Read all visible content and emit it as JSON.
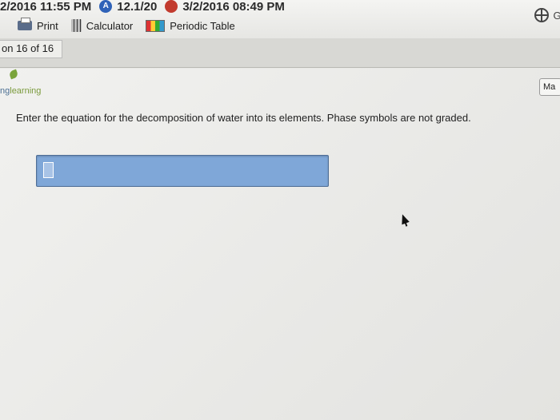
{
  "status_bar": {
    "left_text": "2/2016 11:55 PM",
    "mid_text": "12.1/20",
    "right_text": "3/2/2016 08:49 PM"
  },
  "toolbar": {
    "print_label": "Print",
    "calculator_label": "Calculator",
    "periodic_label": "Periodic Table",
    "global_label": "Gr"
  },
  "question_tab": {
    "label": "on 16 of 16"
  },
  "brand": {
    "prefix": "ng",
    "word": "learning"
  },
  "corner_button": {
    "label": "Ma"
  },
  "question": {
    "text": "Enter the equation for the decomposition of water into its elements. Phase symbols are not graded."
  },
  "answer_field": {
    "value": ""
  },
  "colors": {
    "answer_blue": "#7fa7d8",
    "brand_green": "#7a9a3c"
  }
}
